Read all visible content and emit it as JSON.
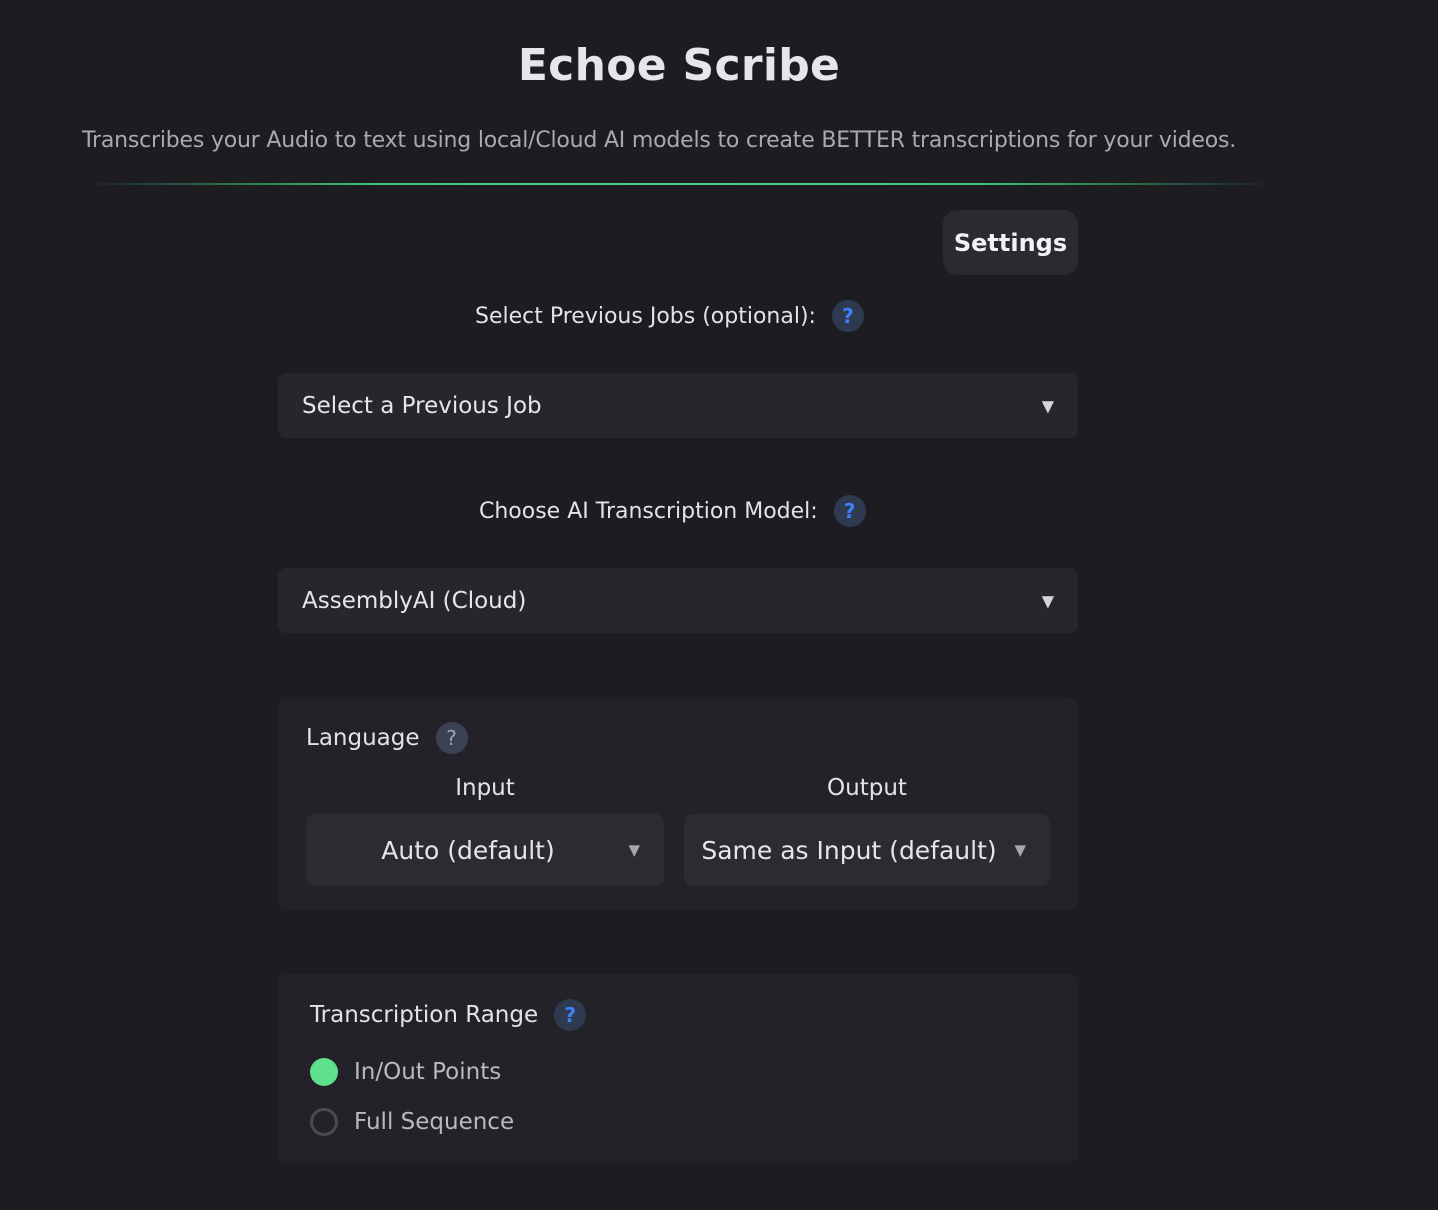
{
  "app": {
    "title": "Echoe Scribe",
    "subtitle": "Transcribes your Audio to text using local/Cloud AI models to create BETTER transcriptions for your videos."
  },
  "header": {
    "settings_label": "Settings"
  },
  "previous_jobs": {
    "label": "Select Previous Jobs (optional):",
    "help": "?",
    "selected": "Select a Previous Job",
    "arrow": "▼"
  },
  "model": {
    "label": "Choose AI Transcription Model:",
    "help": "?",
    "selected": "AssemblyAI (Cloud)",
    "arrow": "▼"
  },
  "language": {
    "title": "Language",
    "help": "?",
    "input_label": "Input",
    "input_selected": "Auto (default)",
    "output_label": "Output",
    "output_selected": "Same as Input (default)",
    "arrow": "▼"
  },
  "range": {
    "title": "Transcription Range",
    "help": "?",
    "options": [
      {
        "label": "In/Out Points",
        "checked": true
      },
      {
        "label": "Full Sequence",
        "checked": false
      }
    ]
  },
  "colors": {
    "background": "#1c1c21",
    "accent_green": "#5ee08e",
    "help_blue": "#3b82f6"
  },
  "icons": {
    "help": "question-mark-circle-icon",
    "dropdown": "chevron-down-icon",
    "radio": "radio-button-icon"
  }
}
